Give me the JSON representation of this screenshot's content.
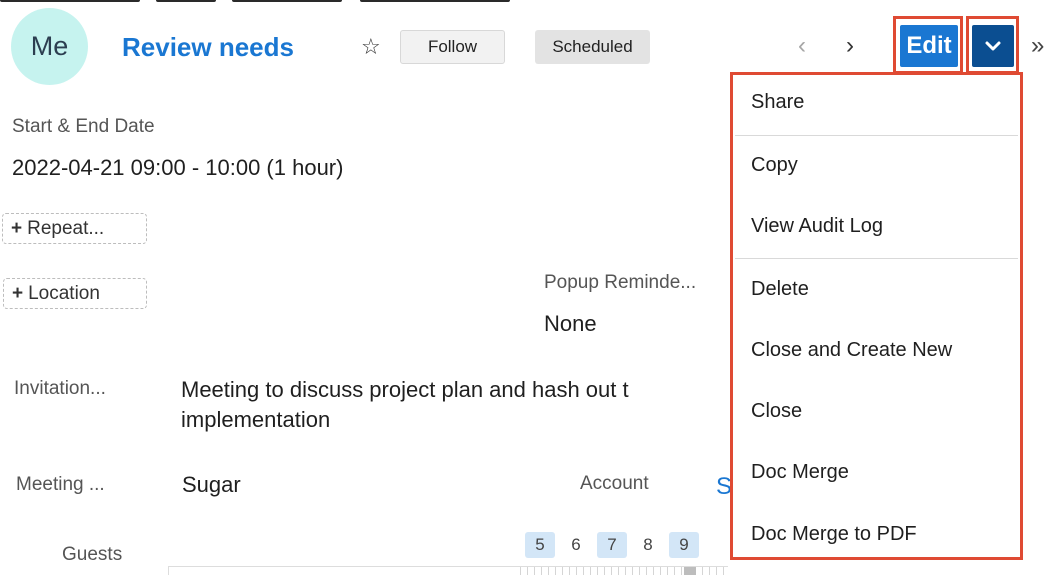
{
  "header": {
    "avatar_initials": "Me",
    "title": "Review needs",
    "follow_label": "Follow",
    "status": "Scheduled",
    "edit_label": "Edit"
  },
  "fields": {
    "start_end_label": "Start & End Date",
    "start_end_value": "2022-04-21 09:00 - 10:00 (1 hour)",
    "repeat_button": "Repeat...",
    "location_button": "Location",
    "popup_reminder_label": "Popup Reminde...",
    "popup_reminder_value": "None",
    "invitation_label": "Invitation...",
    "invitation_line1": "Meeting to discuss project plan and hash out t",
    "invitation_line2": "implementation",
    "meeting_label": "Meeting ...",
    "meeting_value": "Sugar",
    "account_label": "Account",
    "account_value_clipped": "S",
    "guests_label": "Guests",
    "guest_days": [
      "5",
      "6",
      "7",
      "8",
      "9"
    ]
  },
  "menu": {
    "items": [
      "Share",
      "Copy",
      "View Audit Log",
      "Delete",
      "Close and Create New",
      "Close",
      "Doc Merge",
      "Doc Merge to PDF"
    ]
  },
  "colors": {
    "accent": "#1a77d2",
    "edit_dark": "#0b4e91",
    "highlight_outline": "#df4a33",
    "avatar_bg": "#c6f3ef"
  },
  "icons": {
    "favorite": "star-outline",
    "previous": "chevron-left",
    "next": "chevron-right",
    "actions": "chevron-down",
    "more": "double-chevron-right"
  }
}
